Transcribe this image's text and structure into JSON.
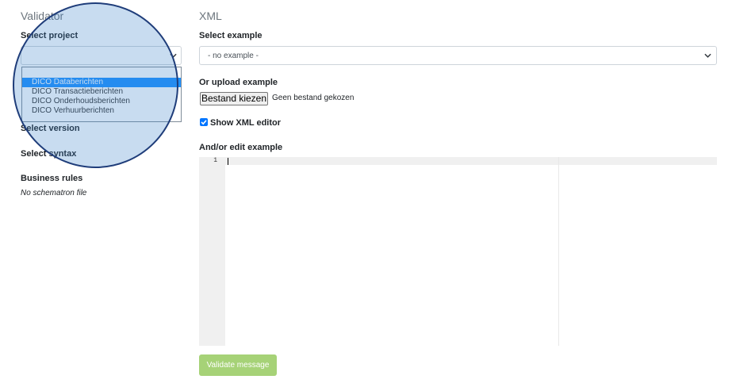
{
  "left": {
    "title": "Validator",
    "project_label": "Select project",
    "project_selected": "",
    "project_options": [
      "DICO Databerichten",
      "DICO Transactieberichten",
      "DICO Onderhoudsberichten",
      "DICO Verhuurberichten"
    ],
    "version_label": "Select version",
    "syntax_label": "Select syntax",
    "rules_label": "Business rules",
    "rules_value": "No schematron file"
  },
  "right": {
    "title": "XML",
    "example_label": "Select example",
    "example_selected": "- no example -",
    "upload_label": "Or upload example",
    "file_button": "Bestand kiezen",
    "file_status": "Geen bestand gekozen",
    "show_editor_label": "Show XML editor",
    "show_editor_checked": true,
    "edit_label": "And/or edit example",
    "editor_line_number": "1",
    "validate_button": "Validate message"
  },
  "colors": {
    "accent": "#0075ff",
    "selected_option": "#1e90ff",
    "validate_button": "#a6d277",
    "magnifier_border": "#1f3d7a"
  }
}
